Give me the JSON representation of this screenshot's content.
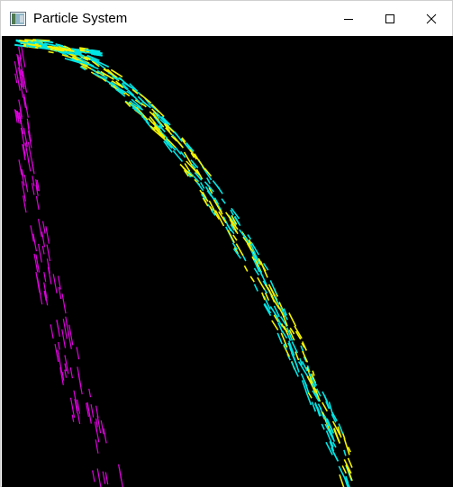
{
  "window": {
    "title": "Particle System",
    "icon": "app-window-icon",
    "controls": [
      "minimize-icon",
      "maximize-icon",
      "close-icon"
    ]
  },
  "canvas": {
    "background": "#000000",
    "colors": {
      "cyan": "#00e5e5",
      "yellow": "#f2f200",
      "magenta": "#e000e0"
    }
  }
}
